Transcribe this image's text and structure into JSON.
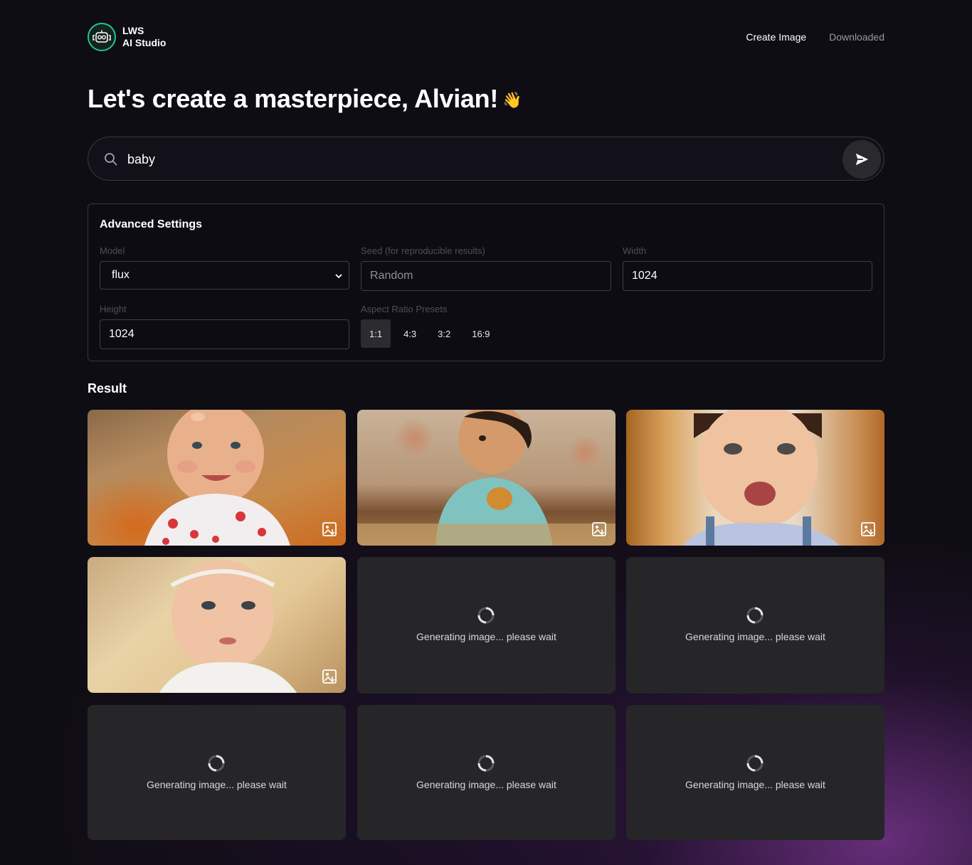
{
  "brand": {
    "line1": "LWS",
    "line2": "AI Studio"
  },
  "nav": {
    "create": "Create Image",
    "downloaded": "Downloaded"
  },
  "hero": {
    "title": "Let's create a masterpiece, Alvian!",
    "emoji": "👋"
  },
  "search": {
    "value": "baby"
  },
  "settings": {
    "title": "Advanced Settings",
    "model_label": "Model",
    "model_value": "flux",
    "seed_label": "Seed (for reproducible results)",
    "seed_placeholder": "Random",
    "width_label": "Width",
    "width_value": "1024",
    "height_label": "Height",
    "height_value": "1024",
    "presets_label": "Aspect Ratio Presets",
    "presets": [
      "1:1",
      "4:3",
      "3:2",
      "16:9"
    ],
    "selected_preset": "1:1"
  },
  "results": {
    "title": "Result",
    "loading_text": "Generating image... please wait",
    "cards": [
      {
        "state": "image"
      },
      {
        "state": "image"
      },
      {
        "state": "image"
      },
      {
        "state": "image"
      },
      {
        "state": "loading"
      },
      {
        "state": "loading"
      },
      {
        "state": "loading"
      },
      {
        "state": "loading"
      },
      {
        "state": "loading"
      }
    ]
  },
  "colors": {
    "accent": "#22c58b",
    "card_bg": "#262629",
    "glow": "#76348c"
  }
}
